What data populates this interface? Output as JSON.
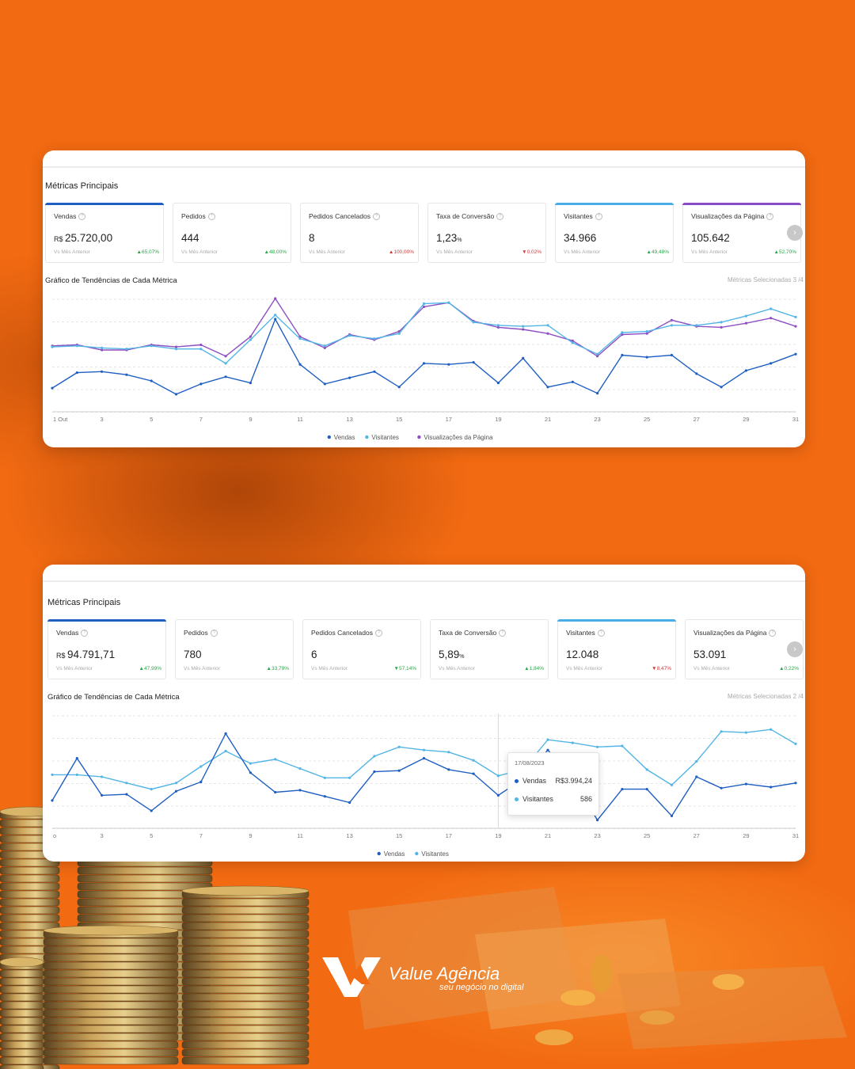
{
  "panels": [
    {
      "title": "Métricas Principais",
      "cards": [
        {
          "name": "Vendas",
          "currency": "R$",
          "value": "25.720,00",
          "suffix": "",
          "compare": "Vs Mês Anterior",
          "delta": "65,07%",
          "dir": "up",
          "accent": "#1f5fc2"
        },
        {
          "name": "Pedidos",
          "currency": "",
          "value": "444",
          "suffix": "",
          "compare": "Vs Mês Anterior",
          "delta": "48,00%",
          "dir": "up",
          "accent": ""
        },
        {
          "name": "Pedidos Cancelados",
          "currency": "",
          "value": "8",
          "suffix": "",
          "compare": "Vs Mês Anterior",
          "delta": "100,00%",
          "dir": "up-red",
          "accent": ""
        },
        {
          "name": "Taxa de Conversão",
          "currency": "",
          "value": "1,23",
          "suffix": "%",
          "compare": "Vs Mês Anterior",
          "delta": "0,02%",
          "dir": "down",
          "accent": ""
        },
        {
          "name": "Visitantes",
          "currency": "",
          "value": "34.966",
          "suffix": "",
          "compare": "Vs Mês Anterior",
          "delta": "49,48%",
          "dir": "up",
          "accent": "#4aaee6"
        },
        {
          "name": "Visualizações da Página",
          "currency": "",
          "value": "105.642",
          "suffix": "",
          "compare": "Vs Mês Anterior",
          "delta": "52,70%",
          "dir": "up",
          "accent": "#8a4bc4"
        }
      ],
      "chart_title": "Gráfico de Tendências de Cada Métrica",
      "selected": "Métricas Selecionadas 3 /4",
      "chart_data": {
        "type": "line",
        "x": [
          1,
          2,
          3,
          4,
          5,
          6,
          7,
          8,
          9,
          10,
          11,
          12,
          13,
          14,
          15,
          16,
          17,
          18,
          19,
          20,
          21,
          22,
          23,
          24,
          25,
          26,
          27,
          28,
          29,
          30,
          31
        ],
        "x_tick_labels": [
          "1 Out",
          "3",
          "5",
          "7",
          "9",
          "11",
          "13",
          "15",
          "17",
          "19",
          "21",
          "23",
          "25",
          "27",
          "29",
          "31"
        ],
        "legend_position": "bottom",
        "grid": true,
        "ylim": [
          0,
          100
        ],
        "series": [
          {
            "name": "Vendas",
            "color": "#1f5fc2",
            "values": [
              23,
              38,
              39,
              36,
              30,
              17,
              27,
              34,
              28,
              90,
              46,
              27,
              33,
              39,
              24,
              47,
              46,
              48,
              28,
              52,
              24,
              29,
              18,
              55,
              53,
              55,
              37,
              24,
              40,
              47,
              56
            ]
          },
          {
            "name": "Visitantes",
            "color": "#52b5e6",
            "values": [
              63,
              64,
              62,
              61,
              64,
              61,
              61,
              47,
              70,
              94,
              71,
              64,
              74,
              71,
              76,
              105,
              106,
              87,
              84,
              83,
              84,
              67,
              56,
              77,
              78,
              84,
              84,
              87,
              93,
              100,
              92
            ]
          },
          {
            "name": "Visualizações da Página",
            "color": "#8d4fc2",
            "values": [
              64,
              65,
              60,
              60,
              65,
              63,
              65,
              54,
              73,
              110,
              73,
              62,
              75,
              70,
              78,
              102,
              106,
              88,
              82,
              80,
              76,
              69,
              54,
              75,
              76,
              89,
              83,
              82,
              86,
              91,
              83
            ]
          }
        ]
      }
    },
    {
      "title": "Métricas Principais",
      "cards": [
        {
          "name": "Vendas",
          "currency": "R$",
          "value": "94.791,71",
          "suffix": "",
          "compare": "Vs Mês Anterior",
          "delta": "47,99%",
          "dir": "up",
          "accent": "#1f5fc2"
        },
        {
          "name": "Pedidos",
          "currency": "",
          "value": "780",
          "suffix": "",
          "compare": "Vs Mês Anterior",
          "delta": "33,79%",
          "dir": "up",
          "accent": ""
        },
        {
          "name": "Pedidos Cancelados",
          "currency": "",
          "value": "6",
          "suffix": "",
          "compare": "Vs Mês Anterior",
          "delta": "57,14%",
          "dir": "down-green",
          "accent": ""
        },
        {
          "name": "Taxa de Conversão",
          "currency": "",
          "value": "5,89",
          "suffix": "%",
          "compare": "Vs Mês Anterior",
          "delta": "1,84%",
          "dir": "up",
          "accent": ""
        },
        {
          "name": "Visitantes",
          "currency": "",
          "value": "12.048",
          "suffix": "",
          "compare": "Vs Mês Anterior",
          "delta": "8,47%",
          "dir": "down",
          "accent": "#4aaee6"
        },
        {
          "name": "Visualizações da Página",
          "currency": "",
          "value": "53.091",
          "suffix": "",
          "compare": "Vs Mês Anterior",
          "delta": "0,22%",
          "dir": "up",
          "accent": ""
        }
      ],
      "chart_title": "Gráfico de Tendências de Cada Métrica",
      "selected": "Métricas Selecionadas 2 /4",
      "tooltip": {
        "date": "17/08/2023",
        "rows": [
          {
            "label": "Vendas",
            "value": "R$3.994,24",
            "color": "#1f5fc2"
          },
          {
            "label": "Visitantes",
            "value": "586",
            "color": "#52b5e6"
          }
        ]
      },
      "chart_data": {
        "type": "line",
        "x": [
          1,
          2,
          3,
          4,
          5,
          6,
          7,
          8,
          9,
          10,
          11,
          12,
          13,
          14,
          15,
          16,
          17,
          18,
          19,
          20,
          21,
          22,
          23,
          24,
          25,
          26,
          27,
          28,
          29,
          30,
          31
        ],
        "x_tick_labels": [
          "o",
          "3",
          "5",
          "7",
          "9",
          "11",
          "13",
          "15",
          "17",
          "19",
          "21",
          "23",
          "25",
          "27",
          "29",
          "31"
        ],
        "legend_position": "bottom",
        "grid": true,
        "ylim": [
          0,
          100
        ],
        "series": [
          {
            "name": "Vendas",
            "color": "#1f5fc2",
            "values": [
              27,
              68,
              32,
              33,
              17,
              36,
              45,
              92,
              54,
              35,
              37,
              31,
              25,
              55,
              56,
              68,
              57,
              53,
              32,
              48,
              76,
              48,
              8,
              38,
              38,
              12,
              50,
              39,
              43,
              40,
              44
            ]
          },
          {
            "name": "Visitantes",
            "color": "#52b5e6",
            "values": [
              52,
              52,
              50,
              44,
              38,
              44,
              60,
              75,
              63,
              67,
              58,
              49,
              49,
              70,
              79,
              76,
              74,
              66,
              51,
              57,
              86,
              83,
              79,
              80,
              57,
              42,
              65,
              94,
              93,
              96,
              82
            ]
          }
        ]
      }
    }
  ],
  "brand": {
    "name": "Value Agência",
    "tagline": "seu negócio no digital"
  }
}
